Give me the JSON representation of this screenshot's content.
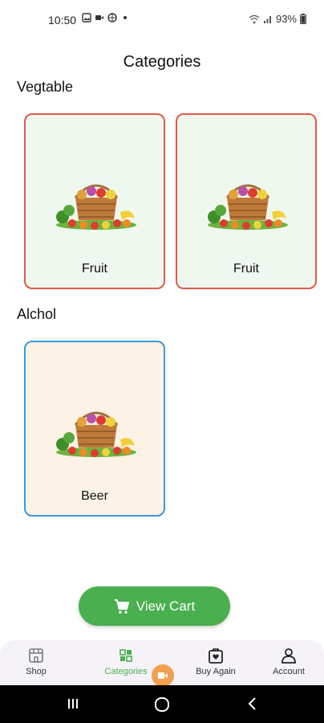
{
  "status": {
    "time": "10:50",
    "battery": "93%"
  },
  "title": "Categories",
  "sections": [
    {
      "title": "Vegtable",
      "items": [
        {
          "label": "Fruit"
        },
        {
          "label": "Fruit"
        }
      ]
    },
    {
      "title": "Alchol",
      "items": [
        {
          "label": "Beer"
        }
      ]
    }
  ],
  "cart_button": {
    "label": "View Cart"
  },
  "nav": [
    {
      "label": "Shop",
      "icon": "store-icon"
    },
    {
      "label": "Categories",
      "icon": "grid-icon",
      "active": true
    },
    {
      "label": "Buy Again",
      "icon": "shopping-bag-heart-icon"
    },
    {
      "label": "Account",
      "icon": "person-icon"
    }
  ],
  "colors": {
    "accent": "#4aaf4f",
    "veg_border": "#e05b4a",
    "alc_border": "#3a98db"
  }
}
